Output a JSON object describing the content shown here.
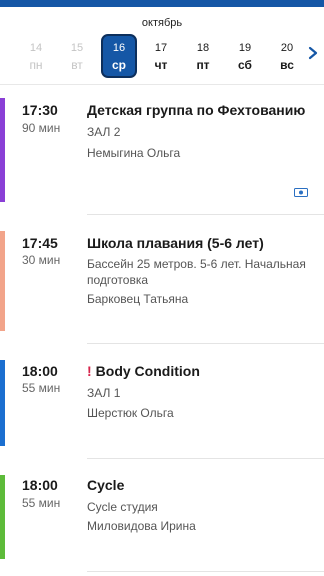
{
  "calendar": {
    "month": "октябрь",
    "days": [
      {
        "num": "14",
        "name": "пн",
        "state": "past"
      },
      {
        "num": "15",
        "name": "вт",
        "state": "past"
      },
      {
        "num": "16",
        "name": "ср",
        "state": "selected"
      },
      {
        "num": "17",
        "name": "чт",
        "state": "future"
      },
      {
        "num": "18",
        "name": "пт",
        "state": "future"
      },
      {
        "num": "19",
        "name": "сб",
        "state": "future"
      },
      {
        "num": "20",
        "name": "вс",
        "state": "future"
      }
    ]
  },
  "classes": [
    {
      "time": "17:30",
      "duration": "90 мин",
      "title": "Детская группа по Фехтованию",
      "details": "ЗАЛ 2",
      "coach": "Немыгина Ольга",
      "color": "#8a3fd6",
      "paid_icon": "money-icon",
      "warning": false
    },
    {
      "time": "17:45",
      "duration": "30 мин",
      "title": "Школа плавания (5-6 лет)",
      "details": "Бассейн 25 метров. 5-6 лет. Начальная подготовка",
      "coach": "Барковец Татьяна",
      "color": "#f2a48a",
      "warning": false
    },
    {
      "time": "18:00",
      "duration": "55 мин",
      "title": "Body Condition",
      "details": "ЗАЛ 1",
      "coach": "Шерстюк Ольга",
      "color": "#1b6fd0",
      "warning": true,
      "warning_mark": "!"
    },
    {
      "time": "18:00",
      "duration": "55 мин",
      "title": "Cycle",
      "details": "Cycle студия",
      "coach": "Миловидова Ирина",
      "color": "#5dbb3a",
      "warning": false
    }
  ],
  "icons": {
    "next": "chevron-right-icon",
    "paid": "money-icon"
  },
  "colors": {
    "accent": "#1557a6",
    "warning": "#d6234a"
  }
}
